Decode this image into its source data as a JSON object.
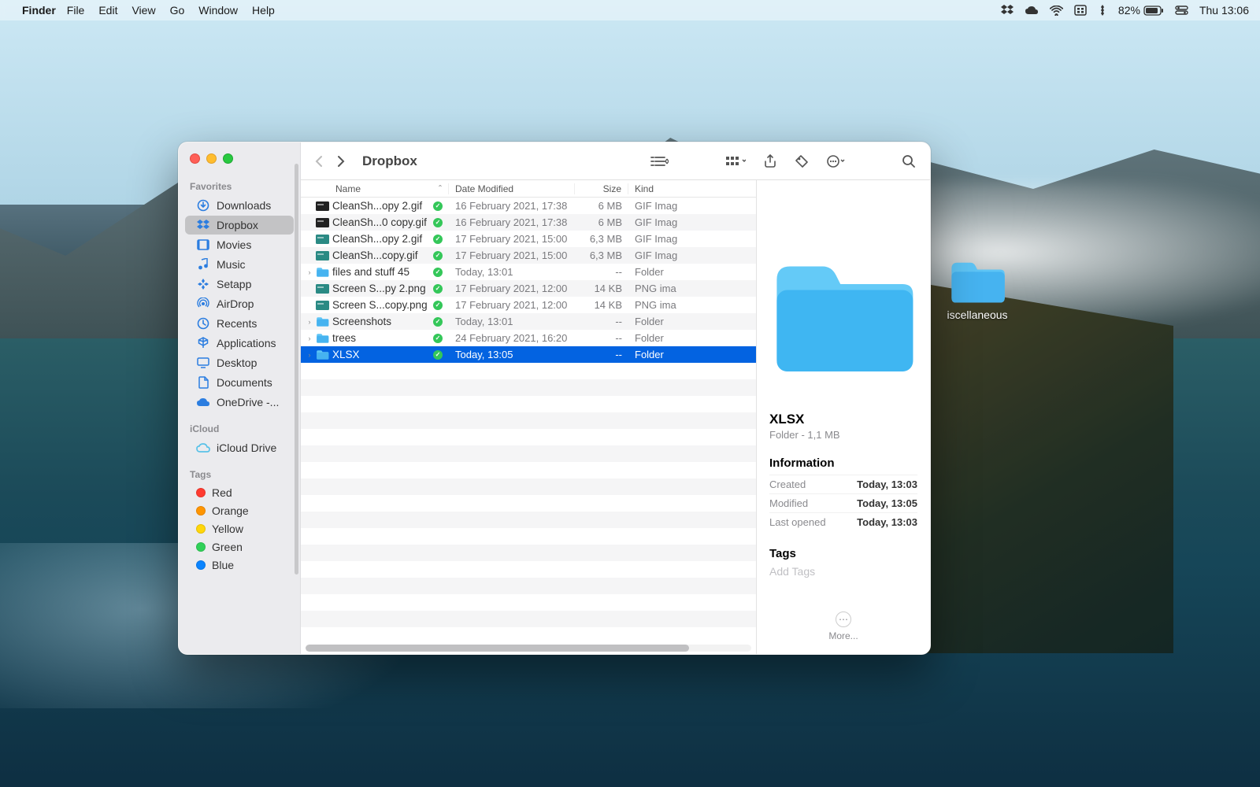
{
  "menubar": {
    "app": "Finder",
    "items": [
      "File",
      "Edit",
      "View",
      "Go",
      "Window",
      "Help"
    ],
    "battery_pct": "82%",
    "clock": "Thu 13:06"
  },
  "desktop": {
    "folder_label": "iscellaneous"
  },
  "window": {
    "title": "Dropbox",
    "columns": {
      "name": "Name",
      "date": "Date Modified",
      "size": "Size",
      "kind": "Kind"
    },
    "sidebar": {
      "favorites_label": "Favorites",
      "favorites": [
        {
          "icon": "download",
          "label": "Downloads"
        },
        {
          "icon": "dropbox",
          "label": "Dropbox",
          "active": true
        },
        {
          "icon": "movies",
          "label": "Movies"
        },
        {
          "icon": "music",
          "label": "Music"
        },
        {
          "icon": "setapp",
          "label": "Setapp"
        },
        {
          "icon": "airdrop",
          "label": "AirDrop"
        },
        {
          "icon": "recents",
          "label": "Recents"
        },
        {
          "icon": "apps",
          "label": "Applications"
        },
        {
          "icon": "desktop",
          "label": "Desktop"
        },
        {
          "icon": "docs",
          "label": "Documents"
        },
        {
          "icon": "onedrive",
          "label": "OneDrive -..."
        }
      ],
      "icloud_label": "iCloud",
      "icloud": [
        {
          "icon": "icloud",
          "label": "iCloud Drive"
        }
      ],
      "tags_label": "Tags",
      "tags": [
        {
          "color": "#ff3b30",
          "label": "Red"
        },
        {
          "color": "#ff9500",
          "label": "Orange"
        },
        {
          "color": "#ffd60a",
          "label": "Yellow"
        },
        {
          "color": "#30d158",
          "label": "Green"
        },
        {
          "color": "#0a84ff",
          "label": "Blue"
        }
      ]
    },
    "rows": [
      {
        "disc": "",
        "thumb": "gif-dark",
        "name": "CleanSh...opy 2.gif",
        "badge": true,
        "date": "16 February 2021, 17:38",
        "size": "6 MB",
        "kind": "GIF Imag"
      },
      {
        "disc": "",
        "thumb": "gif-dark",
        "name": "CleanSh...0 copy.gif",
        "badge": true,
        "date": "16 February 2021, 17:38",
        "size": "6 MB",
        "kind": "GIF Imag"
      },
      {
        "disc": "",
        "thumb": "gif-teal",
        "name": "CleanSh...opy 2.gif",
        "badge": true,
        "date": "17 February 2021, 15:00",
        "size": "6,3 MB",
        "kind": "GIF Imag"
      },
      {
        "disc": "",
        "thumb": "gif-teal",
        "name": "CleanSh...copy.gif",
        "badge": true,
        "date": "17 February 2021, 15:00",
        "size": "6,3 MB",
        "kind": "GIF Imag"
      },
      {
        "disc": "›",
        "thumb": "folder",
        "name": "files and stuff 45",
        "badge": true,
        "date": "Today, 13:01",
        "size": "--",
        "kind": "Folder"
      },
      {
        "disc": "",
        "thumb": "png-teal",
        "name": "Screen S...py 2.png",
        "badge": true,
        "date": "17 February 2021, 12:00",
        "size": "14 KB",
        "kind": "PNG ima"
      },
      {
        "disc": "",
        "thumb": "png-teal",
        "name": "Screen S...copy.png",
        "badge": true,
        "date": "17 February 2021, 12:00",
        "size": "14 KB",
        "kind": "PNG ima"
      },
      {
        "disc": "›",
        "thumb": "folder",
        "name": "Screenshots",
        "badge": true,
        "date": "Today, 13:01",
        "size": "--",
        "kind": "Folder"
      },
      {
        "disc": "›",
        "thumb": "folder",
        "name": "trees",
        "badge": true,
        "date": "24 February 2021, 16:20",
        "size": "--",
        "kind": "Folder"
      },
      {
        "disc": "›",
        "thumb": "folder",
        "name": "XLSX",
        "badge": true,
        "date": "Today, 13:05",
        "size": "--",
        "kind": "Folder",
        "selected": true
      }
    ],
    "preview": {
      "name": "XLSX",
      "subtitle": "Folder - 1,1 MB",
      "info_label": "Information",
      "created_label": "Created",
      "created_val": "Today, 13:03",
      "modified_label": "Modified",
      "modified_val": "Today, 13:05",
      "lastopen_label": "Last opened",
      "lastopen_val": "Today, 13:03",
      "tags_label": "Tags",
      "addtags_placeholder": "Add Tags",
      "more_label": "More..."
    }
  }
}
